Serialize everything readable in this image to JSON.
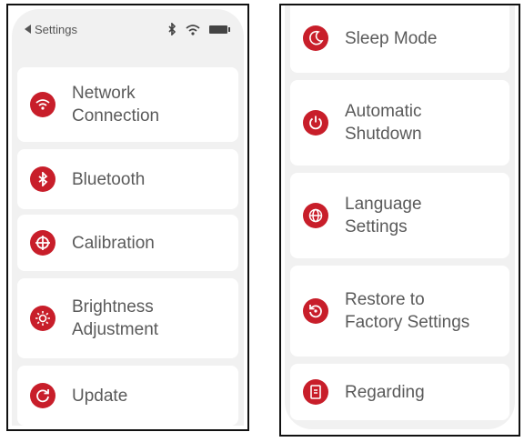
{
  "left_screen": {
    "status_bar": {
      "back_label": "Settings"
    },
    "items": [
      {
        "label": "Network\nConnection",
        "icon": "wifi-icon"
      },
      {
        "label": "Bluetooth",
        "icon": "bluetooth-icon"
      },
      {
        "label": "Calibration",
        "icon": "crosshair-icon"
      },
      {
        "label": "Brightness\nAdjustment",
        "icon": "sun-icon"
      },
      {
        "label": "Update",
        "icon": "refresh-icon"
      }
    ]
  },
  "right_screen": {
    "items": [
      {
        "label": "Sleep Mode",
        "icon": "moon-icon"
      },
      {
        "label": "Automatic\nShutdown",
        "icon": "power-icon"
      },
      {
        "label": "Language\nSettings",
        "icon": "globe-icon"
      },
      {
        "label": "Restore to\nFactory Settings",
        "icon": "restore-icon"
      },
      {
        "label": "Regarding",
        "icon": "info-icon"
      }
    ]
  },
  "colors": {
    "accent": "#c81e2a",
    "card": "#ffffff",
    "background": "#f1f1f1",
    "text": "#5a5a5a"
  }
}
